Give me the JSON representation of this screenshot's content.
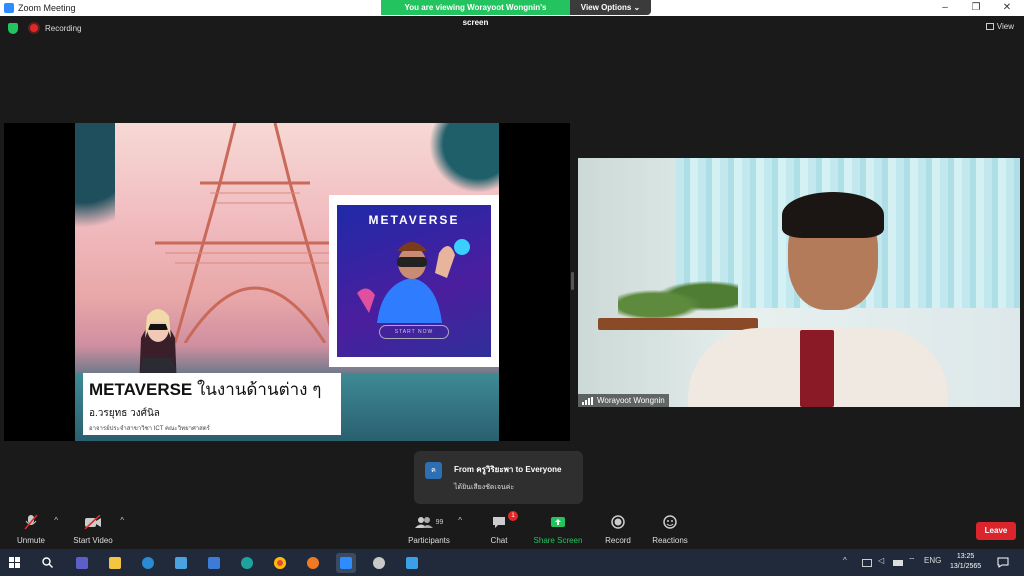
{
  "window": {
    "title": "Zoom Meeting",
    "controls": [
      "–",
      "❐",
      "✕"
    ]
  },
  "share_banner": {
    "viewing": "You are viewing Worayoot Wongnin's screen",
    "options": "View Options ⌄"
  },
  "status": {
    "recording": "Recording",
    "view": "View"
  },
  "slide": {
    "card_title": "METAVERSE",
    "card_button": "START NOW",
    "heading_en": "METAVERSE",
    "heading_th": " ในงานด้านต่าง ๆ",
    "presenter": "อ.วรยุทธ วงศ์นิล",
    "affiliation": "อาจารย์ประจำสาขาวิชา ICT คณะวิทยาศาสตร์"
  },
  "video": {
    "participant_name": "Worayoot Wongnin"
  },
  "chat_toast": {
    "avatar": "ค",
    "from": "From ครูวิริยะพา to Everyone",
    "message": "ได้ยินเสียงชัดเจนค่ะ"
  },
  "toolbar": {
    "unmute": "Unmute",
    "start_video": "Start Video",
    "participants": "Participants",
    "participants_count": "99",
    "chat": "Chat",
    "chat_badge": "1",
    "share_screen": "Share Screen",
    "record": "Record",
    "reactions": "Reactions",
    "leave": "Leave"
  },
  "taskbar": {
    "lang": "ENG",
    "time": "13:25",
    "date": "13/1/2565"
  },
  "colors": {
    "accent_green": "#23c45f",
    "leave_red": "#d9252b",
    "zoom_blue": "#2d8cff"
  }
}
